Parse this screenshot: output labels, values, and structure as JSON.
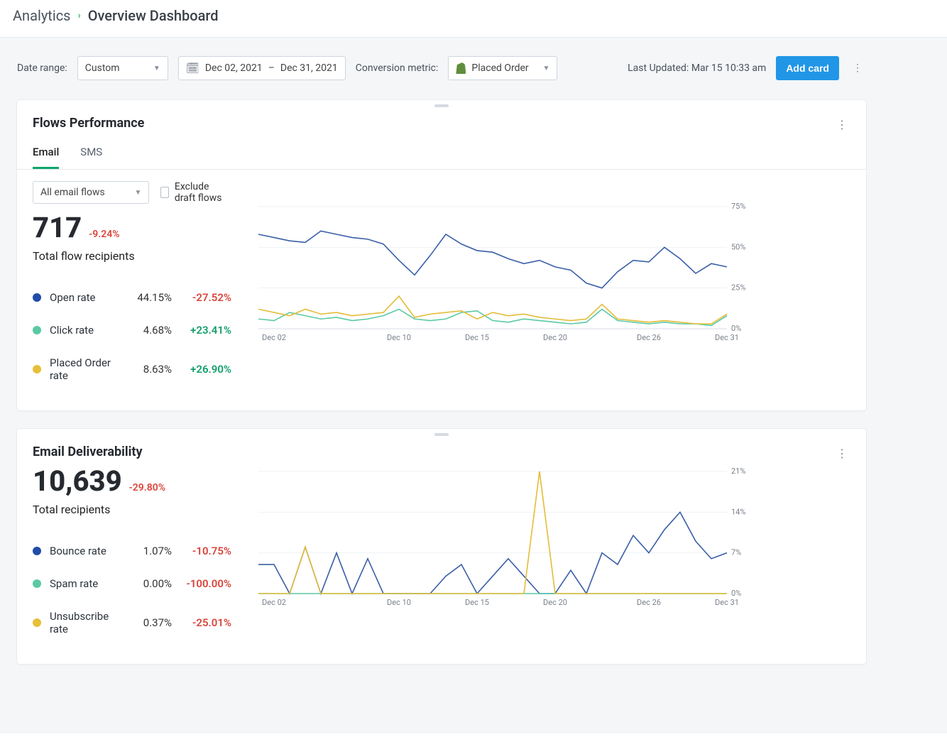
{
  "breadcrumb": {
    "parent": "Analytics",
    "current": "Overview Dashboard"
  },
  "toolbar": {
    "date_label": "Date range:",
    "range_preset": "Custom",
    "date_start": "Dec 02, 2021",
    "date_sep": "–",
    "date_end": "Dec 31, 2021",
    "conv_label": "Conversion metric:",
    "conv_value": "Placed Order",
    "last_updated_label": "Last Updated:",
    "last_updated_value": "Mar 15 10:33 am",
    "add_card": "Add card"
  },
  "card1": {
    "title": "Flows Performance",
    "tabs": [
      "Email",
      "SMS"
    ],
    "active_tab": 0,
    "flow_select": "All email flows",
    "exclude_label": "Exclude draft flows",
    "big_value": "717",
    "big_delta": "-9.24%",
    "big_sub": "Total flow recipients",
    "metrics": [
      {
        "name": "Open rate",
        "value": "44.15%",
        "delta": "-27.52%",
        "dir": "neg",
        "color": "blue"
      },
      {
        "name": "Click rate",
        "value": "4.68%",
        "delta": "+23.41%",
        "dir": "pos",
        "color": "teal"
      },
      {
        "name": "Placed Order rate",
        "value": "8.63%",
        "delta": "+26.90%",
        "dir": "pos",
        "color": "yellow"
      }
    ]
  },
  "card2": {
    "title": "Email Deliverability",
    "big_value": "10,639",
    "big_delta": "-29.80%",
    "big_sub": "Total recipients",
    "metrics": [
      {
        "name": "Bounce rate",
        "value": "1.07%",
        "delta": "-10.75%",
        "dir": "neg",
        "color": "blue"
      },
      {
        "name": "Spam rate",
        "value": "0.00%",
        "delta": "-100.00%",
        "dir": "neg",
        "color": "teal"
      },
      {
        "name": "Unsubscribe rate",
        "value": "0.37%",
        "delta": "-25.01%",
        "dir": "neg",
        "color": "yellow"
      }
    ]
  },
  "chart_data": [
    {
      "type": "line",
      "title": "Flows Performance rates",
      "ylabel": "%",
      "ylim": [
        0,
        75
      ],
      "yticks": [
        0,
        25,
        50,
        75
      ],
      "x": [
        "Dec 01",
        "Dec 02",
        "Dec 03",
        "Dec 04",
        "Dec 05",
        "Dec 06",
        "Dec 07",
        "Dec 08",
        "Dec 09",
        "Dec 10",
        "Dec 11",
        "Dec 12",
        "Dec 13",
        "Dec 14",
        "Dec 15",
        "Dec 16",
        "Dec 17",
        "Dec 18",
        "Dec 19",
        "Dec 20",
        "Dec 21",
        "Dec 22",
        "Dec 23",
        "Dec 24",
        "Dec 25",
        "Dec 26",
        "Dec 27",
        "Dec 28",
        "Dec 29",
        "Dec 30",
        "Dec 31"
      ],
      "xticks": [
        "Dec 02",
        "Dec 10",
        "Dec 15",
        "Dec 20",
        "Dec 26",
        "Dec 31"
      ],
      "series": [
        {
          "name": "Open rate",
          "color": "#3a5fa8",
          "values": [
            58,
            56,
            54,
            53,
            60,
            58,
            56,
            55,
            52,
            42,
            33,
            45,
            58,
            52,
            48,
            47,
            43,
            40,
            42,
            38,
            36,
            28,
            25,
            35,
            42,
            41,
            50,
            43,
            34,
            40,
            38
          ]
        },
        {
          "name": "Click rate",
          "color": "#5ac9a4",
          "values": [
            6,
            5,
            10,
            8,
            6,
            7,
            5,
            6,
            8,
            12,
            6,
            5,
            6,
            10,
            11,
            5,
            4,
            6,
            5,
            4,
            3,
            4,
            12,
            5,
            4,
            3,
            4,
            3,
            3,
            2,
            8
          ]
        },
        {
          "name": "Placed Order rate",
          "color": "#e4bc38",
          "values": [
            12,
            10,
            8,
            12,
            9,
            10,
            8,
            9,
            10,
            20,
            7,
            9,
            10,
            11,
            6,
            10,
            8,
            9,
            7,
            6,
            5,
            6,
            15,
            6,
            5,
            4,
            5,
            4,
            3,
            3,
            9
          ]
        }
      ]
    },
    {
      "type": "line",
      "title": "Email Deliverability rates",
      "ylabel": "%",
      "ylim": [
        0,
        21
      ],
      "yticks": [
        0,
        7,
        14,
        21
      ],
      "x": [
        "Dec 01",
        "Dec 02",
        "Dec 03",
        "Dec 04",
        "Dec 05",
        "Dec 06",
        "Dec 07",
        "Dec 08",
        "Dec 09",
        "Dec 10",
        "Dec 11",
        "Dec 12",
        "Dec 13",
        "Dec 14",
        "Dec 15",
        "Dec 16",
        "Dec 17",
        "Dec 18",
        "Dec 19",
        "Dec 20",
        "Dec 21",
        "Dec 22",
        "Dec 23",
        "Dec 24",
        "Dec 25",
        "Dec 26",
        "Dec 27",
        "Dec 28",
        "Dec 29",
        "Dec 30",
        "Dec 31"
      ],
      "xticks": [
        "Dec 02",
        "Dec 10",
        "Dec 15",
        "Dec 20",
        "Dec 26",
        "Dec 31"
      ],
      "series": [
        {
          "name": "Bounce rate",
          "color": "#3a5fa8",
          "values": [
            5,
            5,
            0,
            8,
            0,
            7,
            0,
            6,
            0,
            0,
            0,
            0,
            3,
            5,
            0,
            3,
            6,
            3,
            0,
            0,
            4,
            0,
            7,
            5,
            10,
            7,
            11,
            14,
            9,
            6,
            7
          ]
        },
        {
          "name": "Spam rate",
          "color": "#5ac9a4",
          "values": [
            0,
            0,
            0,
            0,
            0,
            0,
            0,
            0,
            0,
            0,
            0,
            0,
            0,
            0,
            0,
            0,
            0,
            0,
            0,
            0,
            0,
            0,
            0,
            0,
            0,
            0,
            0,
            0,
            0,
            0,
            0
          ]
        },
        {
          "name": "Unsubscribe rate",
          "color": "#e4bc38",
          "values": [
            0,
            0,
            0,
            8,
            0,
            0,
            0,
            0,
            0,
            0,
            0,
            0,
            0,
            0,
            0,
            0,
            0,
            0,
            21,
            0,
            0,
            0,
            0,
            0,
            0,
            0,
            0,
            0,
            0,
            0,
            0
          ]
        }
      ]
    }
  ]
}
